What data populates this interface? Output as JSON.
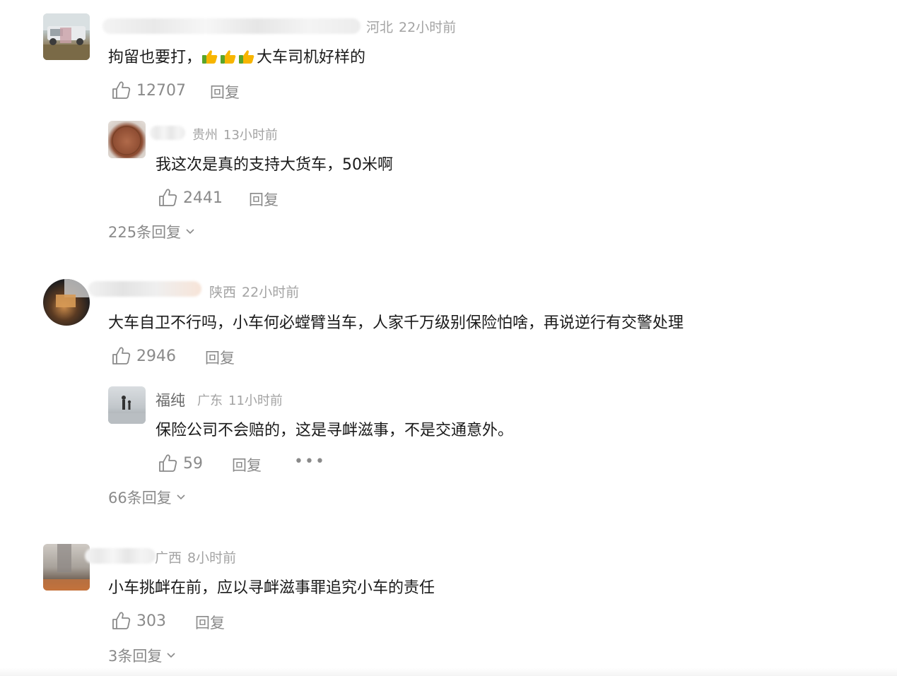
{
  "comments": [
    {
      "location": "河北",
      "time": "22小时前",
      "text_before": "拘留也要打，",
      "emojis": [
        "thumbs-up-emoji",
        "thumbs-up-emoji",
        "thumbs-up-emoji"
      ],
      "text_after": "大车司机好样的",
      "likes": "12707",
      "reply_label": "回复",
      "sub_reply": {
        "location": "贵州",
        "time": "13小时前",
        "text": "我这次是真的支持大货车，50米啊",
        "likes": "2441",
        "reply_label": "回复"
      },
      "expand_label": "225条回复"
    },
    {
      "location": "陕西",
      "time": "22小时前",
      "text": "大车自卫不行吗，小车何必螳臂当车，人家千万级别保险怕啥，再说逆行有交警处理",
      "likes": "2946",
      "reply_label": "回复",
      "sub_reply": {
        "username": "福纯",
        "location": "广东",
        "time": "11小时前",
        "text": "保险公司不会赔的，这是寻衅滋事，不是交通意外。",
        "likes": "59",
        "reply_label": "回复",
        "more_label": "•••"
      },
      "expand_label": "66条回复"
    },
    {
      "location": "广西",
      "time": "8小时前",
      "text": "小车挑衅在前，应以寻衅滋事罪追究小车的责任",
      "likes": "303",
      "reply_label": "回复",
      "expand_label": "3条回复"
    }
  ],
  "icons": {
    "like": "thumbs-up-outline-icon",
    "expand": "chevron-down-icon",
    "emoji": "thumbs-up-emoji"
  },
  "colors": {
    "text": "#1a1a1a",
    "meta": "#a3a3a3",
    "action": "#8a8a8a",
    "emoji_yellow": "#f7b500",
    "emoji_green": "#5aa52a"
  }
}
